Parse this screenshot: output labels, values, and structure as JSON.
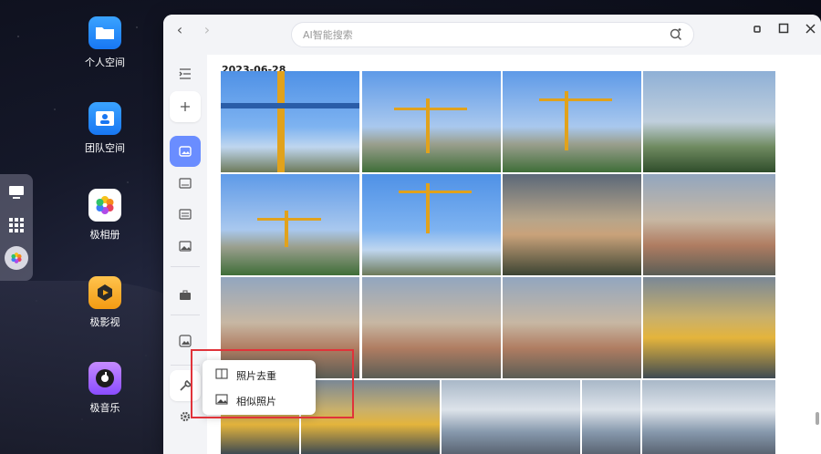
{
  "desktop": {
    "icons": [
      {
        "label": "个人空间",
        "icon": "folder-icon"
      },
      {
        "label": "团队空间",
        "icon": "team-icon"
      },
      {
        "label": "极相册",
        "icon": "photos-icon"
      },
      {
        "label": "极影视",
        "icon": "video-icon"
      },
      {
        "label": "极音乐",
        "icon": "music-icon"
      }
    ]
  },
  "dock": {
    "items": [
      "desktop-icon",
      "app-grid-icon",
      "photos-app-icon"
    ]
  },
  "window": {
    "search": {
      "placeholder": "AI智能搜索"
    },
    "controls": [
      "minimize-icon",
      "maximize-icon",
      "close-icon"
    ]
  },
  "sidebar": {
    "items": [
      "collapse-icon",
      "add-icon",
      "photos-icon",
      "image-icon",
      "album-icon",
      "picture-icon",
      "briefcase-icon",
      "gallery-icon",
      "tools-icon",
      "settings-icon"
    ]
  },
  "content": {
    "date_label": "2023-06-28"
  },
  "popup_menu": {
    "items": [
      {
        "label": "照片去重",
        "icon": "dedupe-icon"
      },
      {
        "label": "相似照片",
        "icon": "similar-photos-icon"
      }
    ]
  },
  "colors": {
    "accent": "#6a8dff",
    "highlight_box": "#e0333a"
  }
}
